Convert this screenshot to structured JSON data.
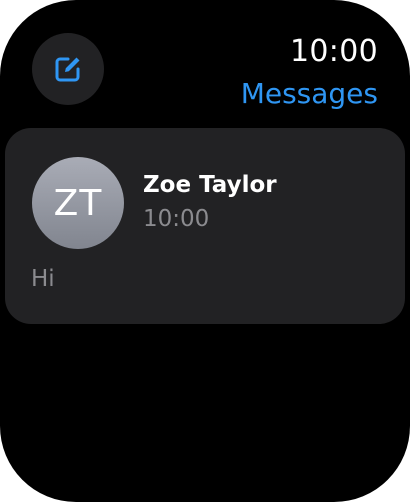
{
  "status_bar": {
    "time": "10:00"
  },
  "header": {
    "title": "Messages",
    "compose_icon": "compose-icon"
  },
  "colors": {
    "accent": "#2f96f3",
    "background": "#000000",
    "card": "#222224"
  },
  "conversations": [
    {
      "avatar_initials": "ZT",
      "name": "Zoe Taylor",
      "time": "10:00",
      "preview": "Hi"
    }
  ]
}
